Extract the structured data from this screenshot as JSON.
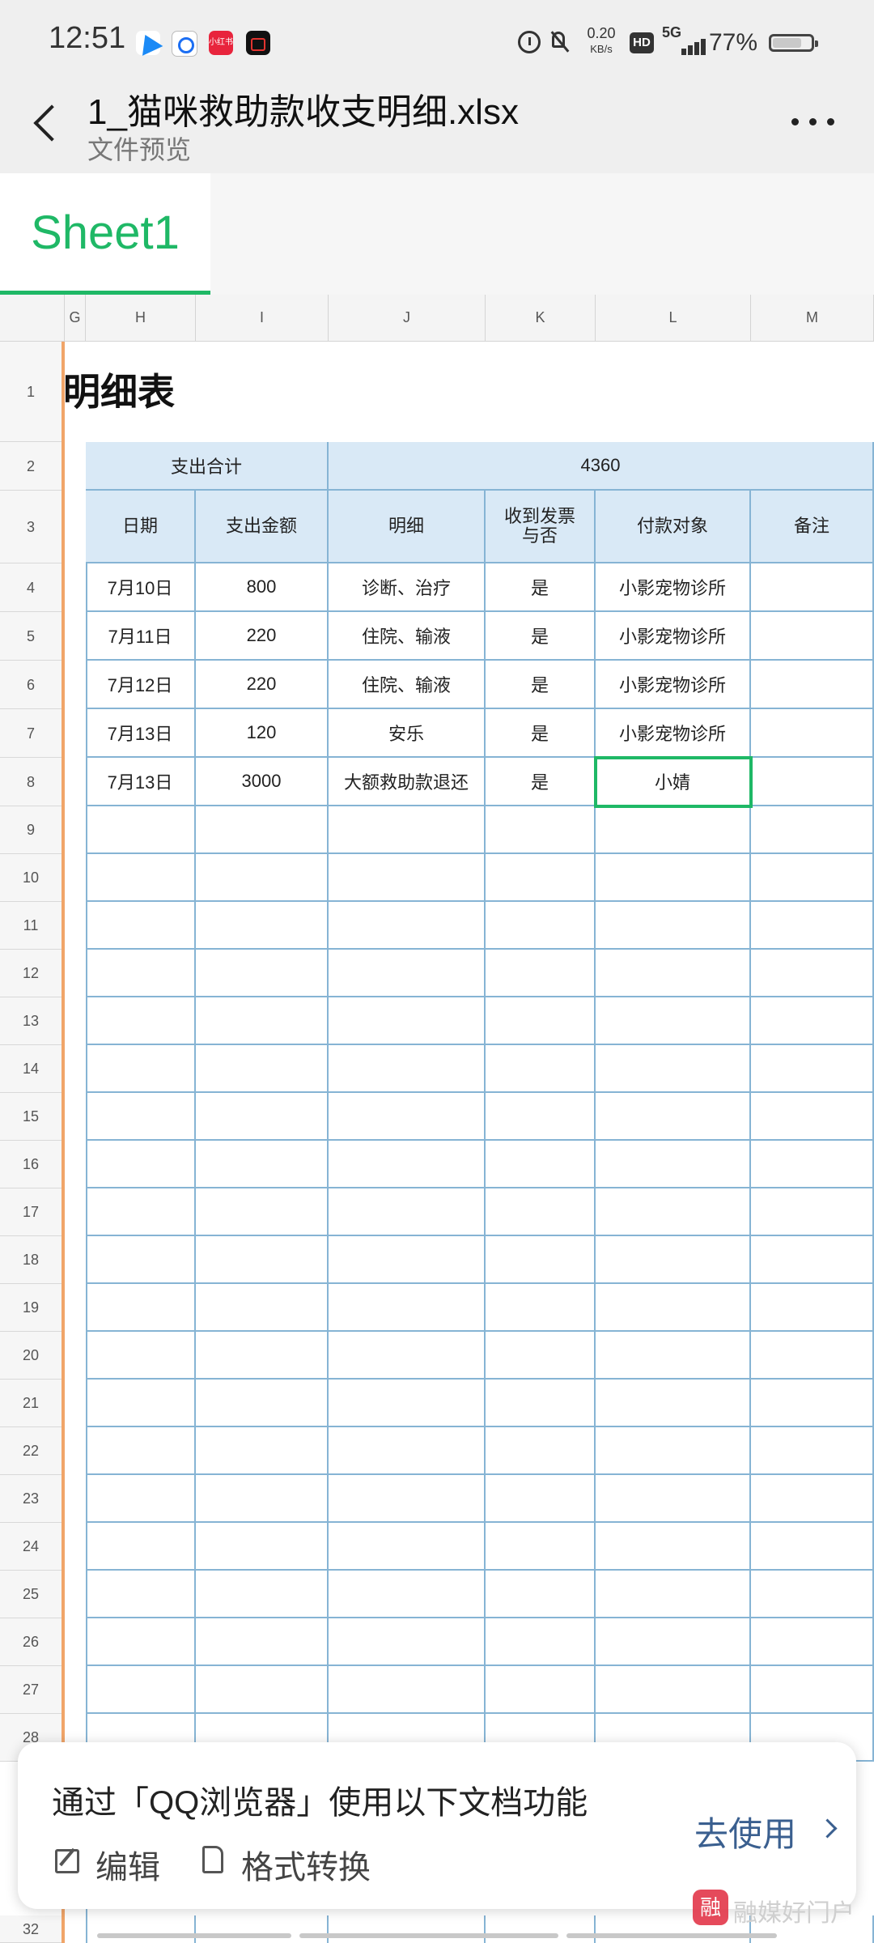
{
  "status_bar": {
    "time": "12:51",
    "xhs_label": "小红书",
    "net_speed_value": "0.20",
    "net_speed_unit": "KB/s",
    "hd_label": "HD",
    "network_label": "5G",
    "battery_percent_text": "77%",
    "battery_level": 0.77
  },
  "header": {
    "file_name": "1_猫咪救助款收支明细.xlsx",
    "subtitle": "文件预览"
  },
  "sheet_tabs": [
    {
      "label": "Sheet1",
      "active": true
    }
  ],
  "grid": {
    "columns": [
      "G",
      "H",
      "I",
      "J",
      "K",
      "L",
      "M"
    ],
    "row_numbers": [
      "1",
      "2",
      "3",
      "4",
      "5",
      "6",
      "7",
      "8",
      "9",
      "10",
      "11",
      "12",
      "13",
      "14",
      "15",
      "16",
      "17",
      "18",
      "19",
      "20",
      "21",
      "22",
      "23",
      "24",
      "25",
      "26",
      "27",
      "28",
      "32"
    ],
    "sheet_title": "明细表",
    "summary_label": "支出合计",
    "summary_value": "4360",
    "table_headers": [
      "日期",
      "支出金额",
      "明细",
      "收到发票\n与否",
      "付款对象",
      "备注"
    ],
    "rows": [
      [
        "7月10日",
        "800",
        "诊断、治疗",
        "是",
        "小影宠物诊所",
        ""
      ],
      [
        "7月11日",
        "220",
        "住院、输液",
        "是",
        "小影宠物诊所",
        ""
      ],
      [
        "7月12日",
        "220",
        "住院、输液",
        "是",
        "小影宠物诊所",
        ""
      ],
      [
        "7月13日",
        "120",
        "安乐",
        "是",
        "小影宠物诊所",
        ""
      ],
      [
        "7月13日",
        "3000",
        "大额救助款退还",
        "是",
        "小婧",
        ""
      ]
    ]
  },
  "banner": {
    "title": "通过「QQ浏览器」使用以下文档功能",
    "edit_label": "编辑",
    "convert_label": "格式转换",
    "go_label": "去使用"
  },
  "watermark": {
    "logo_char": "融",
    "text": "融媒好门户"
  }
}
